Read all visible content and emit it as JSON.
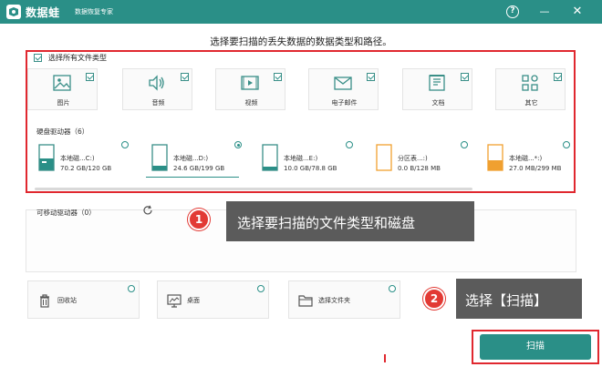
{
  "titlebar": {
    "app_name": "数据蛙",
    "subtitle": "数据恢复专家",
    "help_glyph": "?",
    "minimize_glyph": "—",
    "close_glyph": "✕",
    "bg_color": "#2a8f87"
  },
  "heading": "选择要扫描的丢失数据的数据类型和路径。",
  "file_types": {
    "select_all_label": "选择所有文件类型",
    "items": [
      {
        "label": "图片",
        "checked": true,
        "icon": "image-icon"
      },
      {
        "label": "音频",
        "checked": true,
        "icon": "audio-icon"
      },
      {
        "label": "视频",
        "checked": true,
        "icon": "video-icon"
      },
      {
        "label": "电子邮件",
        "checked": true,
        "icon": "email-icon"
      },
      {
        "label": "文档",
        "checked": true,
        "icon": "document-icon"
      },
      {
        "label": "其它",
        "checked": true,
        "icon": "other-icon"
      }
    ]
  },
  "hard_drives": {
    "label": "硬盘驱动器（6）",
    "items": [
      {
        "name": "本地磁...C:)",
        "size": "70.2 GB/120 GB",
        "selected": false,
        "icon": "drive-icon"
      },
      {
        "name": "本地磁...D:)",
        "size": "24.6 GB/199 GB",
        "selected": true,
        "icon": "drive-icon"
      },
      {
        "name": "本地磁...E:)",
        "size": "10.0 GB/78.8 GB",
        "selected": false,
        "icon": "drive-icon"
      },
      {
        "name": "分区表...:)",
        "size": "0.0 B/128 MB",
        "selected": false,
        "icon": "drive-icon"
      },
      {
        "name": "本地磁...*:)",
        "size": "27.0 MB/299 MB",
        "selected": false,
        "icon": "drive-icon"
      }
    ]
  },
  "removable": {
    "label": "可移动驱动器（0）"
  },
  "callouts": [
    {
      "number": "1",
      "text": "选择要扫描的文件类型和磁盘"
    },
    {
      "number": "2",
      "text": "选择【扫描】"
    }
  ],
  "locations": [
    {
      "label": "回收站",
      "icon": "recycle-bin-icon"
    },
    {
      "label": "桌面",
      "icon": "desktop-icon"
    },
    {
      "label": "选择文件夹",
      "icon": "folder-icon"
    }
  ],
  "scan_button": "扫描",
  "colors": {
    "accent": "#2a8f87",
    "highlight": "#e0282f",
    "callout_bg": "#5b5b5b"
  }
}
